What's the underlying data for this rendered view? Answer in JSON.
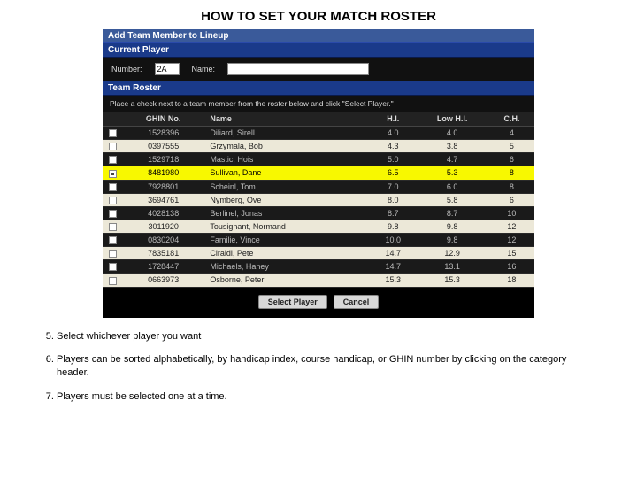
{
  "title": "HOW TO SET YOUR MATCH ROSTER",
  "dialog": {
    "window_title": "Add Team Member to Lineup",
    "current_player": {
      "header": "Current Player",
      "number_label": "Number:",
      "number_value": "2A",
      "name_label": "Name:",
      "name_value": ""
    },
    "team_roster": {
      "header": "Team Roster",
      "instruction": "Place a check next to a team member from the roster below and click \"Select Player.\"",
      "columns": {
        "sel": "",
        "ghin": "GHIN No.",
        "name": "Name",
        "hi": "H.I.",
        "lowhi": "Low H.I.",
        "ch": "C.H."
      },
      "rows": [
        {
          "sel": false,
          "ghin": "1528396",
          "name": "Diliard, Sirell",
          "hi": "4.0",
          "lowhi": "4.0",
          "ch": "4",
          "shade": "dark"
        },
        {
          "sel": false,
          "ghin": "0397555",
          "name": "Grzymala, Bob",
          "hi": "4.3",
          "lowhi": "3.8",
          "ch": "5",
          "shade": "light"
        },
        {
          "sel": false,
          "ghin": "1529718",
          "name": "Mastic, Hois",
          "hi": "5.0",
          "lowhi": "4.7",
          "ch": "6",
          "shade": "dark"
        },
        {
          "sel": true,
          "ghin": "8481980",
          "name": "Sullivan, Dane",
          "hi": "6.5",
          "lowhi": "5.3",
          "ch": "8",
          "shade": "sel"
        },
        {
          "sel": false,
          "ghin": "7928801",
          "name": "Scheinl, Tom",
          "hi": "7.0",
          "lowhi": "6.0",
          "ch": "8",
          "shade": "dark"
        },
        {
          "sel": false,
          "ghin": "3694761",
          "name": "Nymberg, Ove",
          "hi": "8.0",
          "lowhi": "5.8",
          "ch": "6",
          "shade": "light"
        },
        {
          "sel": false,
          "ghin": "4028138",
          "name": "Berlinel, Jonas",
          "hi": "8.7",
          "lowhi": "8.7",
          "ch": "10",
          "shade": "dark"
        },
        {
          "sel": false,
          "ghin": "3011920",
          "name": "Tousignant, Normand",
          "hi": "9.8",
          "lowhi": "9.8",
          "ch": "12",
          "shade": "light"
        },
        {
          "sel": false,
          "ghin": "0830204",
          "name": "Familie, Vince",
          "hi": "10.0",
          "lowhi": "9.8",
          "ch": "12",
          "shade": "dark"
        },
        {
          "sel": false,
          "ghin": "7835181",
          "name": "Ciraldi, Pete",
          "hi": "14.7",
          "lowhi": "12.9",
          "ch": "15",
          "shade": "light"
        },
        {
          "sel": false,
          "ghin": "1728447",
          "name": "Michaels, Haney",
          "hi": "14.7",
          "lowhi": "13.1",
          "ch": "16",
          "shade": "dark"
        },
        {
          "sel": false,
          "ghin": "0663973",
          "name": "Osborne, Peter",
          "hi": "15.3",
          "lowhi": "15.3",
          "ch": "18",
          "shade": "light"
        }
      ]
    },
    "buttons": {
      "select": "Select Player",
      "cancel": "Cancel"
    }
  },
  "steps": {
    "start": 5,
    "items": [
      "Select whichever player you want",
      "Players can be sorted alphabetically, by handicap index, course handicap, or GHIN number by clicking on the category header.",
      "Players must be selected one at a time."
    ]
  }
}
